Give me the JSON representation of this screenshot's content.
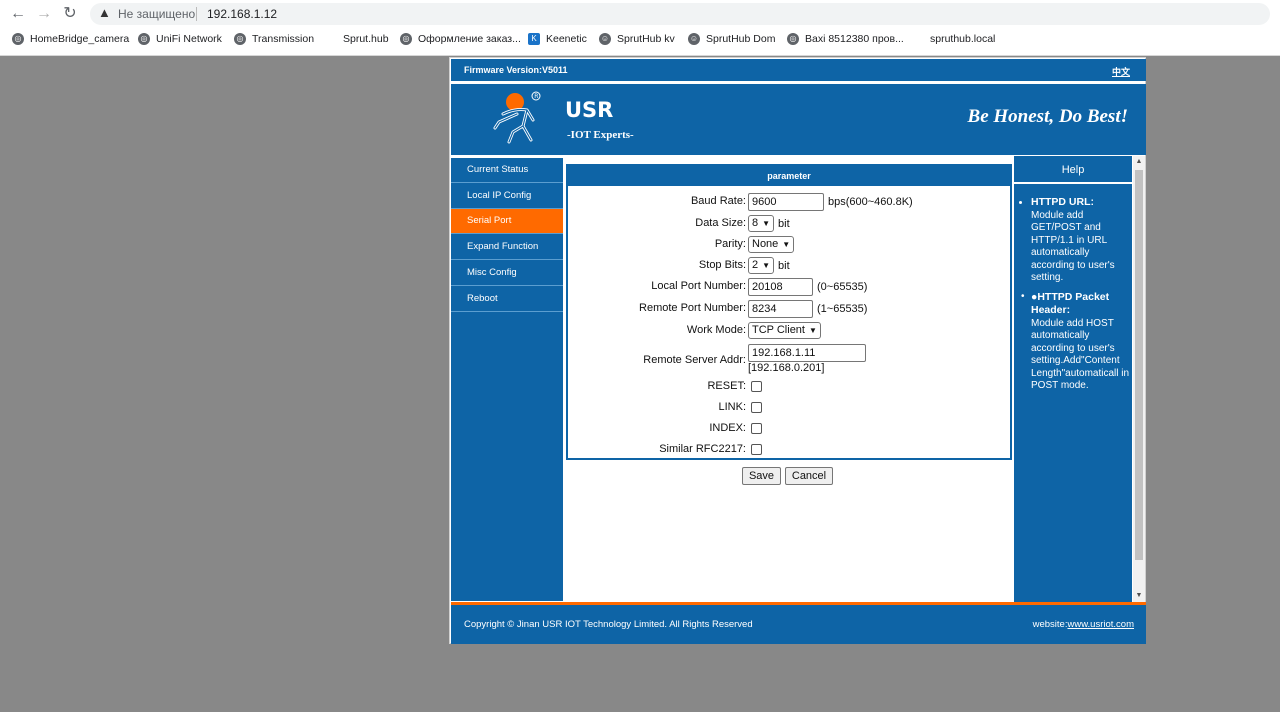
{
  "browser": {
    "security_label": "Не защищено",
    "url": "192.168.1.12",
    "bookmarks": [
      {
        "label": "HomeBridge_camera",
        "icon": "globe-icon"
      },
      {
        "label": "UniFi Network",
        "icon": "globe-icon"
      },
      {
        "label": "Transmission",
        "icon": "globe-icon"
      },
      {
        "label": "Sprut.hub",
        "icon": ""
      },
      {
        "label": "Оформление заказ...",
        "icon": "globe-icon"
      },
      {
        "label": "Keenetic",
        "icon": "keenetic-icon"
      },
      {
        "label": "SprutHub kv",
        "icon": "user-icon"
      },
      {
        "label": "SprutHub Dom",
        "icon": "user-icon"
      },
      {
        "label": "Baxi 8512380 пров...",
        "icon": "globe-icon"
      },
      {
        "label": "spruthub.local",
        "icon": ""
      }
    ]
  },
  "device": {
    "firmware": "Firmware Version:V5011",
    "language_link": "中文",
    "brand": "USR",
    "brand_sub": "-IOT Experts-",
    "slogan": "Be Honest, Do Best!",
    "accent_color": "#0e64a6",
    "active_color": "#ff6a00"
  },
  "menu": {
    "items": [
      {
        "label": "Current Status"
      },
      {
        "label": "Local IP Config"
      },
      {
        "label": "Serial Port",
        "active": true
      },
      {
        "label": "Expand Function"
      },
      {
        "label": "Misc Config"
      },
      {
        "label": "Reboot"
      }
    ]
  },
  "form": {
    "header": "parameter",
    "baud_rate": {
      "label": "Baud Rate:",
      "value": "9600",
      "suffix": "bps(600~460.8K)"
    },
    "data_size": {
      "label": "Data Size:",
      "value": "8",
      "suffix": "bit"
    },
    "parity": {
      "label": "Parity:",
      "value": "None"
    },
    "stop_bits": {
      "label": "Stop Bits:",
      "value": "2",
      "suffix": "bit"
    },
    "local_port": {
      "label": "Local Port Number:",
      "value": "20108",
      "suffix": "(0~65535)"
    },
    "remote_port": {
      "label": "Remote Port Number:",
      "value": "8234",
      "suffix": "(1~65535)"
    },
    "work_mode": {
      "label": "Work Mode:",
      "value": "TCP Client"
    },
    "remote_server": {
      "label": "Remote Server Addr:",
      "value": "192.168.1.11",
      "note": "[192.168.0.201]"
    },
    "reset": {
      "label": "RESET:",
      "checked": false
    },
    "link": {
      "label": "LINK:",
      "checked": false
    },
    "index": {
      "label": "INDEX:",
      "checked": false
    },
    "rfc2217": {
      "label": "Similar RFC2217:",
      "checked": false
    },
    "save_label": "Save",
    "cancel_label": "Cancel"
  },
  "help": {
    "title": "Help",
    "item1_title": "HTTPD URL:",
    "item1_text": "Module add GET/POST and HTTP/1.1 in URL automatically according to user's setting.",
    "item2_title": "●HTTPD Packet Header:",
    "item2_text": "Module add HOST automatically according to user's setting.Add\"Content Length\"automaticall in POST mode."
  },
  "footer": {
    "copyright": "Copyright © Jinan USR IOT Technology Limited. All Rights Reserved",
    "website_label": "website:",
    "website_link": "www.usriot.com"
  }
}
